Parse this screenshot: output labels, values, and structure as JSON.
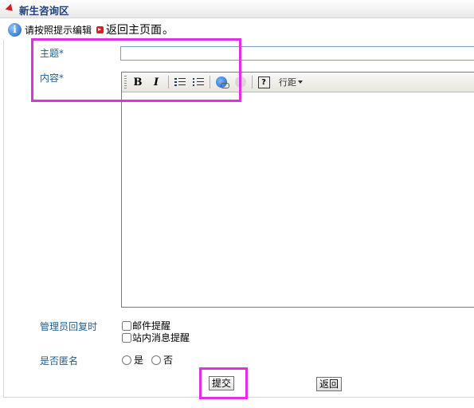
{
  "header": {
    "title": "新生咨询区"
  },
  "hint": {
    "text": "请按照提示编辑",
    "return_link": "返回主页面",
    "period": "。"
  },
  "form": {
    "subject_label": "主题*",
    "subject_value": "",
    "content_label": "内容*",
    "reply_label": "管理员回复时",
    "notify_email": "邮件提醒",
    "notify_site": "站内消息提醒",
    "anonymous_label": "是否匿名",
    "anon_yes": "是",
    "anon_no": "否"
  },
  "toolbar": {
    "bold": "B",
    "italic": "I",
    "help": "?",
    "spacing": "行距"
  },
  "buttons": {
    "submit": "提交",
    "back": "返回"
  },
  "colors": {
    "title": "#1f3e7c",
    "label": "#1f5d8e",
    "highlight": "#e030e0",
    "triangle": "#cc2222"
  }
}
